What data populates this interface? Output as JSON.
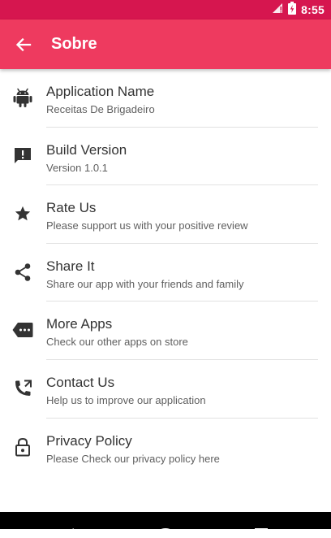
{
  "status_bar": {
    "time": "8:55"
  },
  "app_bar": {
    "title": "Sobre"
  },
  "items": [
    {
      "icon": "android-icon",
      "title": "Application Name",
      "subtitle": "Receitas De Brigadeiro"
    },
    {
      "icon": "feedback-icon",
      "title": "Build Version",
      "subtitle": "Version 1.0.1"
    },
    {
      "icon": "star-icon",
      "title": "Rate Us",
      "subtitle": "Please support us with your positive review"
    },
    {
      "icon": "share-icon",
      "title": "Share It",
      "subtitle": "Share our app with your friends and family"
    },
    {
      "icon": "more-apps-icon",
      "title": "More Apps",
      "subtitle": "Check our other apps on store"
    },
    {
      "icon": "phone-forward-icon",
      "title": "Contact Us",
      "subtitle": "Help us to improve our application"
    },
    {
      "icon": "lock-icon",
      "title": "Privacy Policy",
      "subtitle": "Please Check our privacy policy here"
    }
  ],
  "colors": {
    "status_bar": "#d6164f",
    "app_bar": "#ee3a5f",
    "icon": "#333333"
  }
}
